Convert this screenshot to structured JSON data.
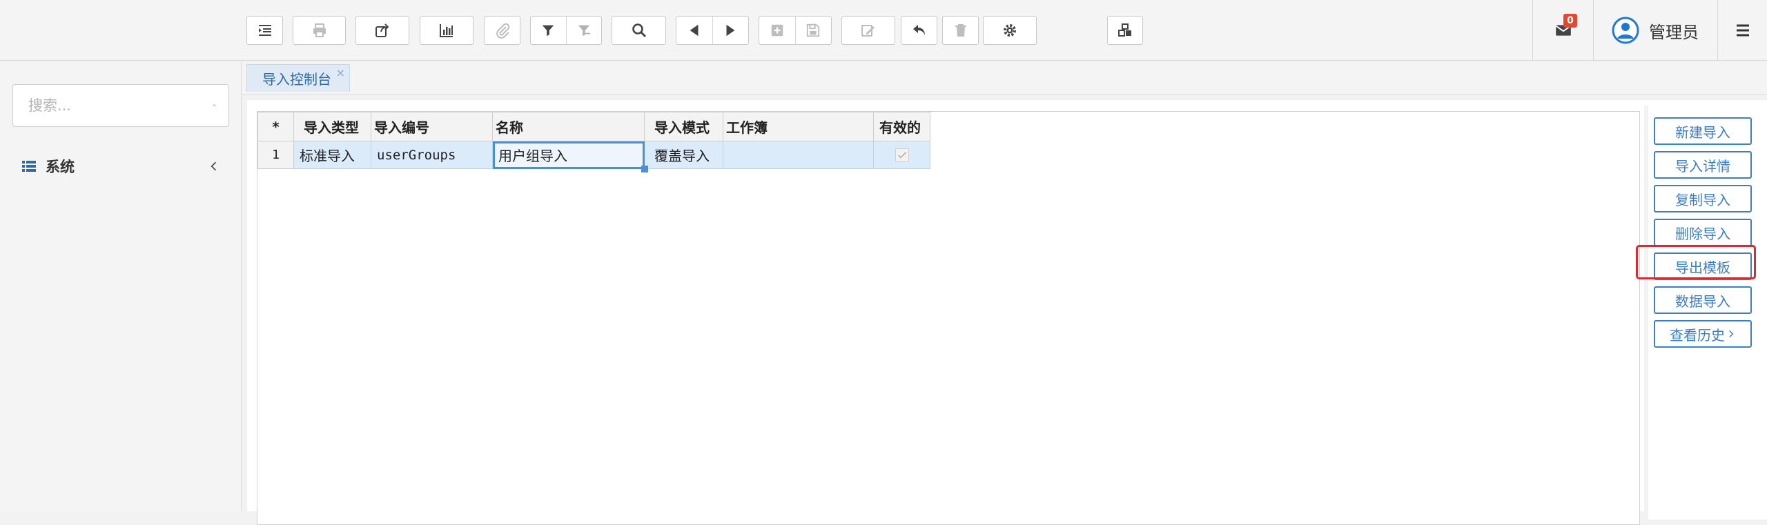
{
  "topbar": {
    "icons": [
      "indent-icon",
      "print-icon",
      "share-icon",
      "chart-icon",
      "attachment-icon",
      "filter-icon",
      "clear-filter-icon",
      "search-icon",
      "prev-icon",
      "next-icon",
      "add-icon",
      "save-icon",
      "edit-icon",
      "undo-icon",
      "delete-icon",
      "settings-icon",
      "cubes-icon"
    ],
    "mail_count": "0",
    "user_name": "管理员"
  },
  "sidebar": {
    "search_placeholder": "搜索...",
    "items": [
      {
        "label": "系统"
      }
    ]
  },
  "tabs": [
    {
      "label": "导入控制台",
      "close": "×"
    }
  ],
  "grid": {
    "headers": [
      "*",
      "导入类型",
      "导入编号",
      "名称",
      "导入模式",
      "工作簿",
      "有效的"
    ],
    "rows": [
      {
        "num": "1",
        "type": "标准导入",
        "code": "userGroups",
        "name": "用户组导入",
        "mode": "覆盖导入",
        "workbook": "",
        "valid": true
      }
    ]
  },
  "actions": {
    "new_import": "新建导入",
    "import_detail": "导入详情",
    "copy_import": "复制导入",
    "delete_import": "删除导入",
    "export_template": "导出模板",
    "data_import": "数据导入",
    "view_history": "查看历史"
  },
  "colors": {
    "accent": "#3d7ec3",
    "highlight": "#e8232a",
    "badge": "#e0492f",
    "row_selected": "#dcebf9"
  }
}
